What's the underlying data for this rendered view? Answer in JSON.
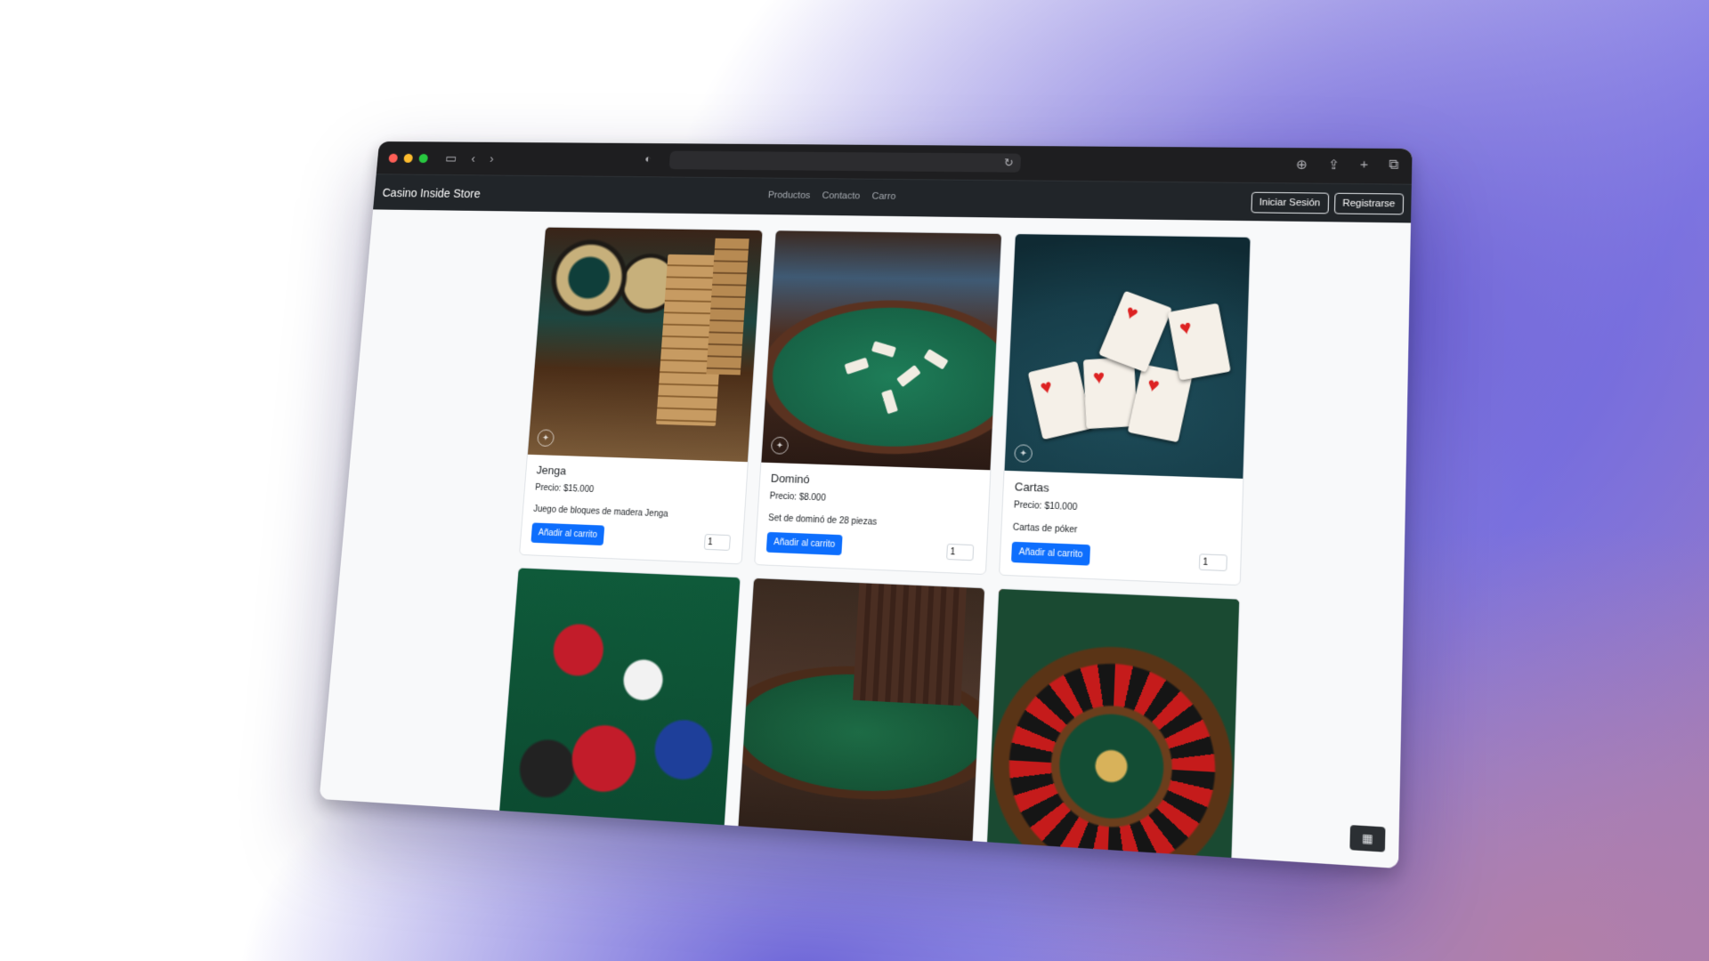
{
  "browser": {
    "icons": [
      "sidebar-icon",
      "back-icon",
      "forward-icon",
      "shield-icon",
      "reload-icon",
      "download-icon",
      "share-icon",
      "new-tab-icon",
      "tabs-overview-icon"
    ],
    "address": ""
  },
  "navbar": {
    "brand": "Casino Inside Store",
    "links": [
      "Productos",
      "Contacto",
      "Carro"
    ],
    "login_label": "Iniciar Sesión",
    "register_label": "Registrarse"
  },
  "products": [
    {
      "name": "Jenga",
      "price": "Precio: $15.000",
      "description": "Juego de bloques de madera Jenga",
      "button": "Añadir al carrito",
      "qty": "1"
    },
    {
      "name": "Dominó",
      "price": "Precio: $8.000",
      "description": "Set de dominó de 28 piezas",
      "button": "Añadir al carrito",
      "qty": "1"
    },
    {
      "name": "Cartas",
      "price": "Precio: $10.000",
      "description": "Cartas de póker",
      "button": "Añadir al carrito",
      "qty": "1"
    }
  ],
  "colors": {
    "primary": "#0d6efd",
    "navbar": "#212529",
    "titlebar": "#1e1e20"
  }
}
